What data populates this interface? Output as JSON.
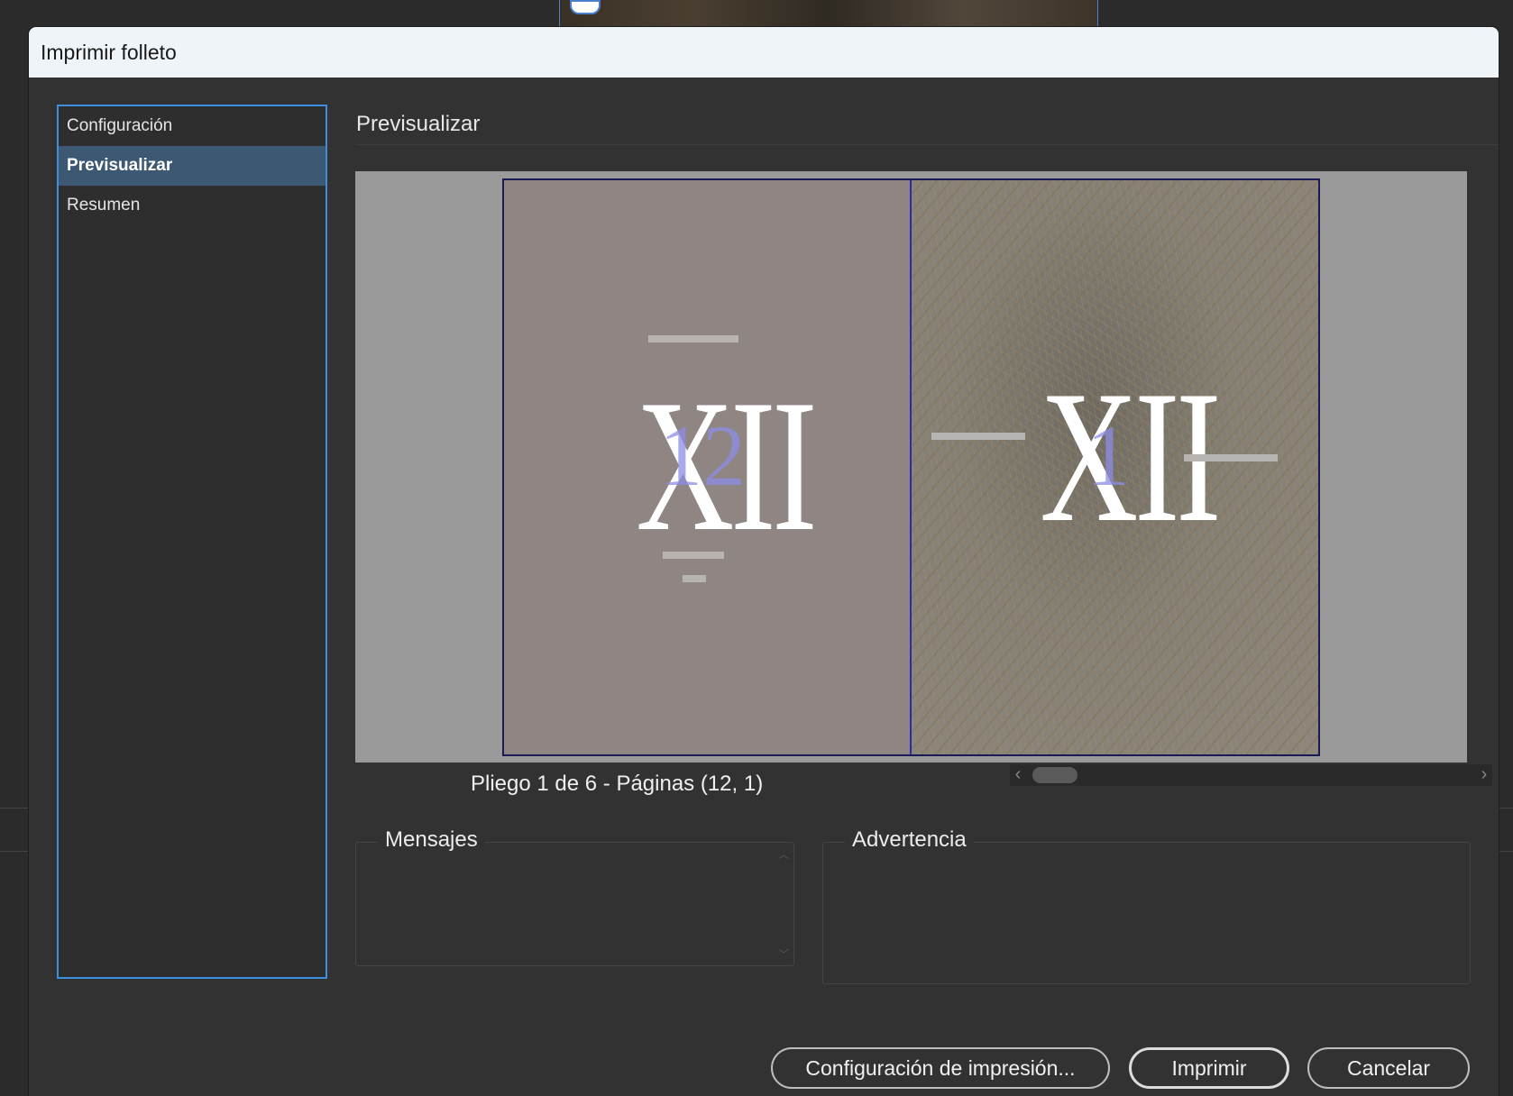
{
  "window": {
    "title": "Imprimir folleto"
  },
  "sidebar": {
    "items": [
      {
        "label": "Configuración",
        "selected": false
      },
      {
        "label": "Previsualizar",
        "selected": true
      },
      {
        "label": "Resumen",
        "selected": false
      }
    ]
  },
  "preview": {
    "section_title": "Previsualizar",
    "left_page": {
      "numeral": "XII",
      "page_number": "12"
    },
    "right_page": {
      "numeral": "XII",
      "page_number": "1"
    },
    "spread_label": "Pliego 1 de 6 - Páginas (12, 1)"
  },
  "messages": {
    "title": "Mensajes"
  },
  "warning": {
    "title": "Advertencia"
  },
  "buttons": {
    "print_setup": "Configuración de impresión...",
    "print": "Imprimir",
    "cancel": "Cancelar"
  },
  "colors": {
    "accent": "#3e8ee0",
    "selected_nav": "#3d5873",
    "dialog_bg": "#323232"
  }
}
